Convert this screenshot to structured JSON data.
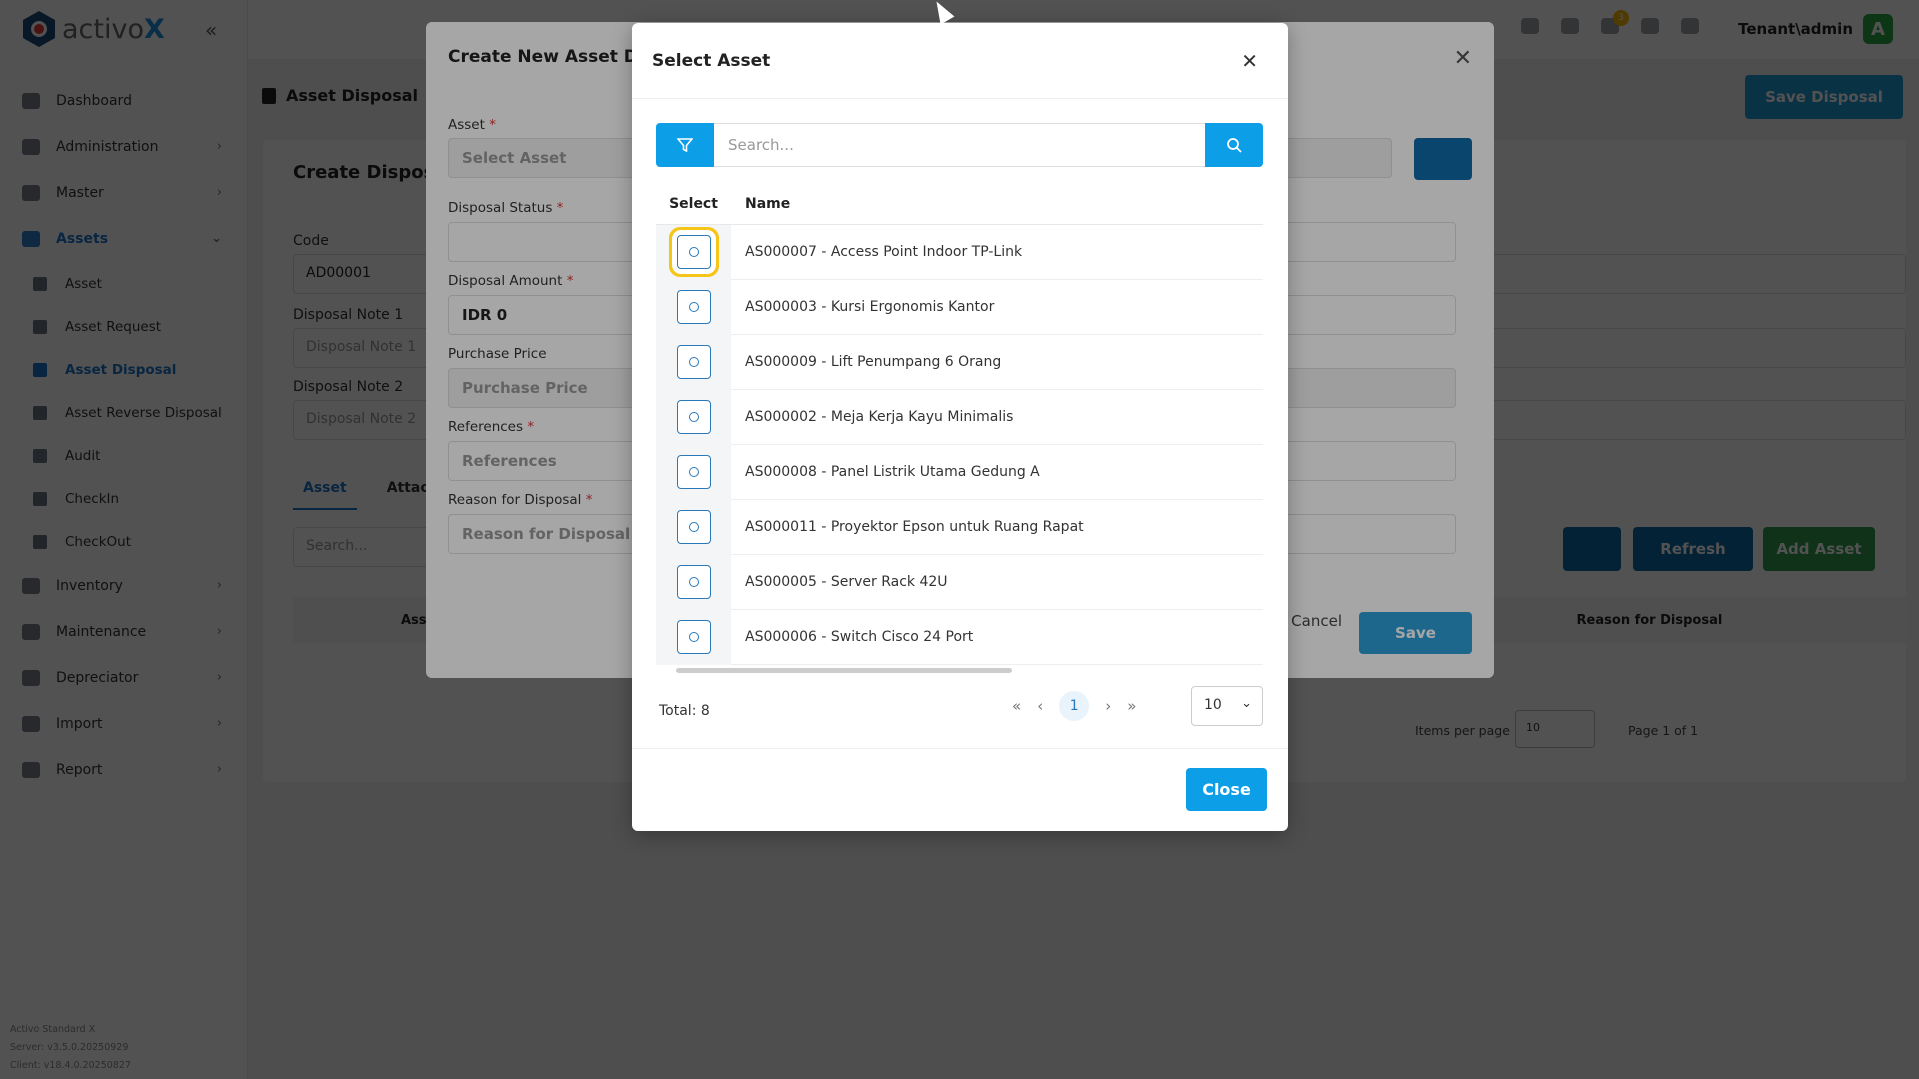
{
  "app": {
    "logo_prefix": "activo",
    "logo_suffix": "X"
  },
  "sidebar": {
    "items": [
      {
        "label": "Dashboard",
        "chev": ""
      },
      {
        "label": "Administration",
        "chev": "›"
      },
      {
        "label": "Master",
        "chev": "›"
      },
      {
        "label": "Assets",
        "chev": "⌄"
      }
    ],
    "sub": [
      {
        "label": "Asset"
      },
      {
        "label": "Asset Request"
      },
      {
        "label": "Asset Disposal"
      },
      {
        "label": "Asset Reverse Disposal"
      },
      {
        "label": "Audit"
      },
      {
        "label": "CheckIn"
      },
      {
        "label": "CheckOut"
      }
    ],
    "items2": [
      {
        "label": "Inventory"
      },
      {
        "label": "Maintenance"
      },
      {
        "label": "Depreciator"
      },
      {
        "label": "Import"
      },
      {
        "label": "Report"
      }
    ],
    "version": [
      "Activo Standard X",
      "Server: v3.5.0.20250929",
      "Client: v18.4.0.20250827"
    ]
  },
  "topbar": {
    "user": "Tenant\\admin",
    "avatar": "A",
    "notif_count": "3"
  },
  "page": {
    "breadcrumb": "Asset Disposal",
    "save_disposal": "Save Disposal",
    "card_title": "Create Disposal",
    "code_label": "Code",
    "code_value": "AD00001",
    "note1_label": "Disposal Note 1",
    "note1_ph": "Disposal Note 1",
    "note2_label": "Disposal Note 2",
    "note2_ph": "Disposal Note 2",
    "tab_asset": "Asset",
    "tab_attach": "Attach",
    "search_ph": "Search...",
    "refresh": "Refresh",
    "add_asset": "Add Asset",
    "col_asset": "Ass",
    "col_reason": "Reason for Disposal",
    "items_per_page": "Items per page",
    "pp_value": "10",
    "page_of": "Page 1 of 1"
  },
  "modal1": {
    "title": "Create New Asset Disp",
    "asset_label": "Asset",
    "asset_ph": "Select Asset",
    "status_label": "Disposal Status",
    "amount_label": "Disposal Amount",
    "amount_value": "IDR 0",
    "price_label": "Purchase Price",
    "price_ph": "Purchase Price",
    "ref_label": "References",
    "ref_ph": "References",
    "reason_label": "Reason for Disposal",
    "reason_ph": "Reason for Disposal",
    "cancel": "Cancel",
    "save": "Save"
  },
  "modal2": {
    "title": "Select Asset",
    "search_ph": "Search...",
    "col_select": "Select",
    "col_name": "Name",
    "rows": [
      "AS000007 - Access Point Indoor TP-Link",
      "AS000003 - Kursi Ergonomis Kantor",
      "AS000009 - Lift Penumpang 6 Orang",
      "AS000002 - Meja Kerja Kayu Minimalis",
      "AS000008 - Panel Listrik Utama Gedung A",
      "AS000011 - Proyektor Epson untuk Ruang Rapat",
      "AS000005 - Server Rack 42U",
      "AS000006 - Switch Cisco 24 Port"
    ],
    "total": "Total: 8",
    "current_page": "1",
    "per_page": "10",
    "close": "Close"
  }
}
